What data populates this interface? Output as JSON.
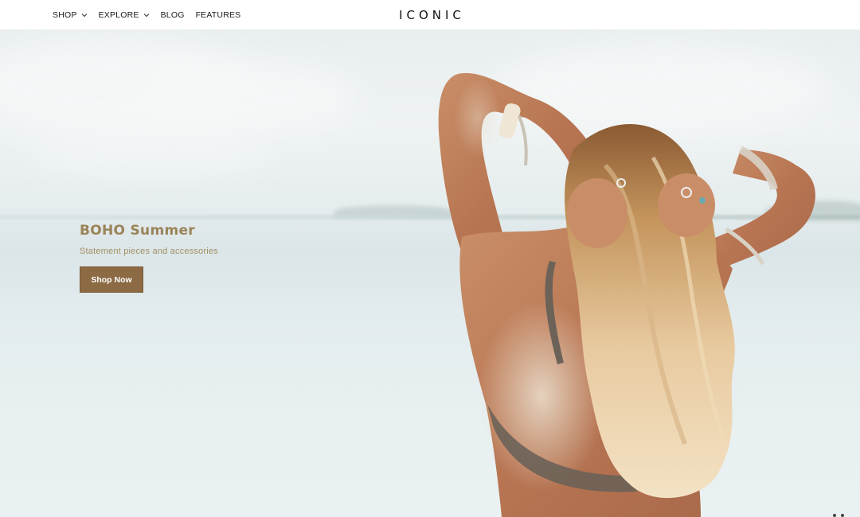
{
  "header": {
    "nav": [
      {
        "label": "SHOP",
        "has_dropdown": true,
        "icon": "chevron-down-icon"
      },
      {
        "label": "EXPLORE",
        "has_dropdown": true,
        "icon": "chevron-down-icon"
      },
      {
        "label": "BLOG",
        "has_dropdown": false
      },
      {
        "label": "FEATURES",
        "has_dropdown": false
      }
    ],
    "logo": "ICONIC"
  },
  "hero": {
    "title": "BOHO Summer",
    "subtitle": "Statement pieces and accessories",
    "button_label": "Shop Now",
    "image": "beach-woman-photo"
  },
  "colors": {
    "accent_brown": "#8b6a44",
    "title_gold": "#9a8358",
    "sky": "#eef2f2",
    "sea": "#dbe6e8"
  }
}
